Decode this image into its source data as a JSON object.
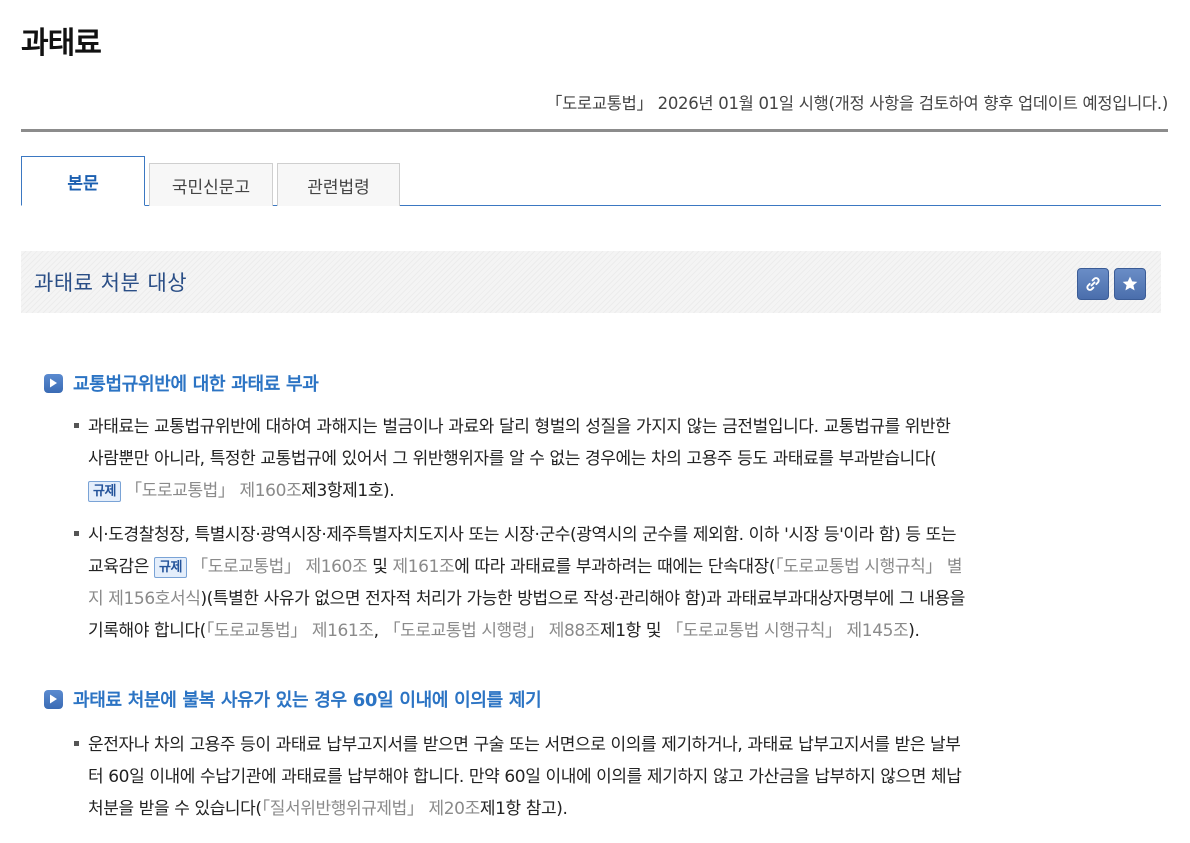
{
  "page": {
    "title": "과태료"
  },
  "law_meta": {
    "text": "「도로교통법」 2026년 01월 01일 시행(개정 사항을 검토하여 향후 업데이트 예정입니다.)"
  },
  "tabs": [
    {
      "label": "본문",
      "active": true
    },
    {
      "label": "국민신문고",
      "active": false
    },
    {
      "label": "관련법령",
      "active": false
    }
  ],
  "section": {
    "title": "과태료 처분 대상",
    "link_icon": "link-icon",
    "star_icon": "star-icon"
  },
  "badge_label": "규제",
  "subsections": [
    {
      "heading": "교통법규위반에 대한 과태료 부과",
      "p1": {
        "l1": "과태료는 교통법규위반에 대하여 과해지는 벌금이나 과료와 달리 형벌의 성질을 가지지 않는 금전벌입니다. 교통법규를 위반한",
        "l2": "사람뿐만 아니라, 특정한 교통법규에 있어서 그 위반행위자를 알 수 없는 경우에는 차의 고용주 등도 과태료를 부과받습니다(",
        "l3_ref": "「도로교통법」 제160조",
        "l3_tail": "제3항제1호)."
      },
      "p2": {
        "l1": "시·도경찰청장, 특별시장·광역시장·제주특별자치도지사 또는 시장·군수(광역시의 군수를 제외함. 이하 '시장 등'이라 함) 등 또는",
        "l2_a": "교육감은",
        "l2_ref1": "「도로교통법」 제160조",
        "l2_b": " 및 ",
        "l2_ref2": "제161조",
        "l2_c": "에 따라 과태료를 부과하려는 때에는 단속대장(",
        "l2_ref3": "「도로교통법 시행규칙」 별",
        "l3_ref": "지 제156호서식",
        "l3_tail": ")(특별한 사유가 없으면 전자적 처리가 가능한 방법으로 작성·관리해야 함)과 과태료부과대상자명부에 그 내용을",
        "l4_a": "기록해야 합니다(",
        "l4_ref1": "「도로교통법」 제161조",
        "l4_b": ", ",
        "l4_ref2": "「도로교통법 시행령」 제88조",
        "l4_c": "제1항 및 ",
        "l4_ref3": "「도로교통법 시행규칙」 제145조",
        "l4_d": ")."
      }
    },
    {
      "heading": "과태료 처분에 불복 사유가 있는 경우 60일 이내에 이의를 제기",
      "p1": {
        "l1": "운전자나 차의 고용주 등이 과태료 납부고지서를 받으면 구술 또는 서면으로 이의를 제기하거나, 과태료 납부고지서를 받은 날부",
        "l2": "터 60일 이내에 수납기관에 과태료를 납부해야 합니다. 만약 60일 이내에 이의를 제기하지 않고 가산금을 납부하지 않으면 체납",
        "l3_a": "처분을 받을 수 있습니다(",
        "l3_ref": "「질서위반행위규제법」 제20조",
        "l3_tail": "제1항 참고)."
      }
    }
  ]
}
